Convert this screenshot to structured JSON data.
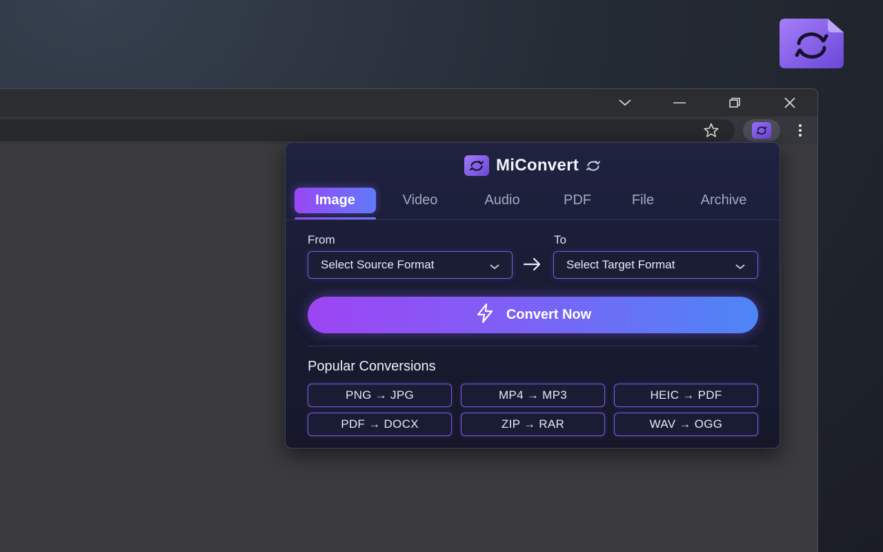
{
  "extension": {
    "title": "MiConvert",
    "tabs": [
      {
        "label": "Image",
        "active": true
      },
      {
        "label": "Video",
        "active": false
      },
      {
        "label": "Audio",
        "active": false
      },
      {
        "label": "PDF",
        "active": false
      },
      {
        "label": "File",
        "active": false
      },
      {
        "label": "Archive",
        "active": false
      }
    ],
    "from_label": "From",
    "to_label": "To",
    "source_select": {
      "value": "Select Source Format"
    },
    "target_select": {
      "value": "Select Target Format"
    },
    "convert_button": "Convert Now",
    "popular_title": "Popular Conversions",
    "popular": [
      "PNG → JPG",
      "MP4 → MP3",
      "HEIC → PDF",
      "PDF → DOCX",
      "ZIP → RAR",
      "WAV → OGG"
    ]
  },
  "browser": {
    "window_controls": [
      "tab-search-icon",
      "minimize-icon",
      "restore-icon",
      "close-icon"
    ],
    "toolbar_icons": [
      "star-icon",
      "extension-icon",
      "kebab-menu-icon"
    ]
  },
  "colors": {
    "accent_purple": "#9a47f5",
    "accent_blue": "#4d86f6",
    "popup_bg": "#1a1c33",
    "border": "#7b5ce8"
  }
}
